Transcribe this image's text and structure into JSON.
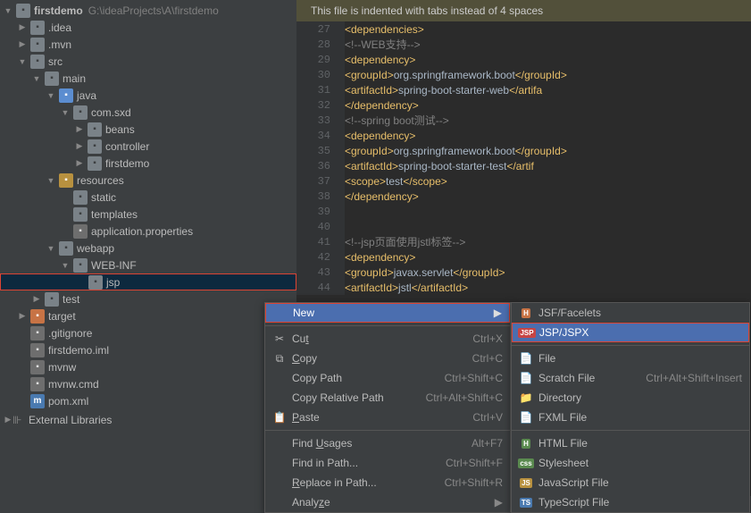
{
  "project": {
    "name": "firstdemo",
    "root": "G:\\ideaProjects\\A\\firstdemo"
  },
  "tree": [
    {
      "lvl": 0,
      "a": "open",
      "ico": "folder",
      "label": "firstdemo",
      "path": 1
    },
    {
      "lvl": 1,
      "a": "closed",
      "ico": "folder",
      "label": ".idea"
    },
    {
      "lvl": 1,
      "a": "closed",
      "ico": "folder",
      "label": ".mvn"
    },
    {
      "lvl": 1,
      "a": "open",
      "ico": "folder",
      "label": "src"
    },
    {
      "lvl": 2,
      "a": "open",
      "ico": "folder",
      "label": "main"
    },
    {
      "lvl": 3,
      "a": "open",
      "ico": "folder-src",
      "label": "java"
    },
    {
      "lvl": 4,
      "a": "open",
      "ico": "folder-pkg",
      "label": "com.sxd"
    },
    {
      "lvl": 5,
      "a": "closed",
      "ico": "folder-pkg",
      "label": "beans"
    },
    {
      "lvl": 5,
      "a": "closed",
      "ico": "folder-pkg",
      "label": "controller"
    },
    {
      "lvl": 5,
      "a": "closed",
      "ico": "folder-pkg",
      "label": "firstdemo"
    },
    {
      "lvl": 3,
      "a": "open",
      "ico": "folder-res",
      "label": "resources"
    },
    {
      "lvl": 4,
      "a": "",
      "ico": "folder",
      "label": "static"
    },
    {
      "lvl": 4,
      "a": "",
      "ico": "folder",
      "label": "templates"
    },
    {
      "lvl": 4,
      "a": "",
      "ico": "file",
      "label": "application.properties"
    },
    {
      "lvl": 3,
      "a": "open",
      "ico": "folder",
      "label": "webapp"
    },
    {
      "lvl": 4,
      "a": "open",
      "ico": "folder",
      "label": "WEB-INF"
    },
    {
      "lvl": 5,
      "a": "",
      "ico": "folder",
      "label": "jsp",
      "sel": 1
    },
    {
      "lvl": 2,
      "a": "closed",
      "ico": "folder",
      "label": "test"
    },
    {
      "lvl": 1,
      "a": "closed",
      "ico": "folder-tgt",
      "label": "target"
    },
    {
      "lvl": 1,
      "a": "",
      "ico": "file",
      "label": ".gitignore"
    },
    {
      "lvl": 1,
      "a": "",
      "ico": "file",
      "label": "firstdemo.iml"
    },
    {
      "lvl": 1,
      "a": "",
      "ico": "file",
      "label": "mvnw"
    },
    {
      "lvl": 1,
      "a": "",
      "ico": "file",
      "label": "mvnw.cmd"
    },
    {
      "lvl": 1,
      "a": "",
      "ico": "m",
      "label": "pom.xml"
    }
  ],
  "ext_lib": "External Libraries",
  "banner": "This file is indented with tabs instead of 4 spaces",
  "code": {
    "start": 27,
    "lines": [
      {
        "ind": 2,
        "t": [
          [
            "tag",
            "<dependencies>"
          ]
        ]
      },
      {
        "ind": 3,
        "t": [
          [
            "cmt",
            "<!--WEB支持-->"
          ]
        ]
      },
      {
        "ind": 3,
        "t": [
          [
            "tag",
            "<dependency>"
          ]
        ]
      },
      {
        "ind": 4,
        "t": [
          [
            "tag",
            "<groupId>"
          ],
          [
            "txt",
            "org.springframework.boot"
          ],
          [
            "tag",
            "</groupId>"
          ]
        ]
      },
      {
        "ind": 4,
        "t": [
          [
            "tag",
            "<artifactId>"
          ],
          [
            "txt",
            "spring-boot-starter-web"
          ],
          [
            "tag",
            "</artifa"
          ]
        ]
      },
      {
        "ind": 3,
        "t": [
          [
            "tag",
            "</dependency>"
          ]
        ]
      },
      {
        "ind": 3,
        "t": [
          [
            "cmt",
            "<!--spring boot测试-->"
          ]
        ]
      },
      {
        "ind": 3,
        "t": [
          [
            "tag",
            "<dependency>"
          ]
        ]
      },
      {
        "ind": 4,
        "t": [
          [
            "tag",
            "<groupId>"
          ],
          [
            "txt",
            "org.springframework.boot"
          ],
          [
            "tag",
            "</groupId>"
          ]
        ]
      },
      {
        "ind": 4,
        "t": [
          [
            "tag",
            "<artifactId>"
          ],
          [
            "txt",
            "spring-boot-starter-test"
          ],
          [
            "tag",
            "</artif"
          ]
        ]
      },
      {
        "ind": 4,
        "t": [
          [
            "tag",
            "<scope>"
          ],
          [
            "txt",
            "test"
          ],
          [
            "tag",
            "</scope>"
          ]
        ]
      },
      {
        "ind": 3,
        "t": [
          [
            "tag",
            "</dependency>"
          ]
        ]
      },
      {
        "ind": 0,
        "t": []
      },
      {
        "ind": 0,
        "t": []
      },
      {
        "ind": 3,
        "t": [
          [
            "cmt",
            "<!--jsp页面使用jstl标签-->"
          ]
        ]
      },
      {
        "ind": 3,
        "t": [
          [
            "tag",
            "<dependency>"
          ]
        ]
      },
      {
        "ind": 4,
        "t": [
          [
            "tag",
            "<groupId>"
          ],
          [
            "txt",
            "javax.servlet"
          ],
          [
            "tag",
            "</groupId>"
          ]
        ]
      },
      {
        "ind": 4,
        "t": [
          [
            "tag",
            "<artifactId>"
          ],
          [
            "txt",
            "jstl"
          ],
          [
            "tag",
            "</artifactId>"
          ]
        ]
      }
    ]
  },
  "menu1": [
    {
      "label": "New",
      "hi": 1,
      "sub": 1,
      "box": 1
    },
    {
      "sep": 1
    },
    {
      "ico": "✂",
      "label": "Cut",
      "u": "t",
      "key": "Ctrl+X"
    },
    {
      "ico": "⧉",
      "label": "Copy",
      "u": "C",
      "key": "Ctrl+C"
    },
    {
      "label": "Copy Path",
      "u": "",
      "key": "Ctrl+Shift+C"
    },
    {
      "label": "Copy Relative Path",
      "key": "Ctrl+Alt+Shift+C"
    },
    {
      "ico": "📋",
      "label": "Paste",
      "u": "P",
      "key": "Ctrl+V"
    },
    {
      "sep": 1
    },
    {
      "label": "Find Usages",
      "u": "U",
      "key": "Alt+F7"
    },
    {
      "label": "Find in Path...",
      "u": "",
      "key": "Ctrl+Shift+F"
    },
    {
      "label": "Replace in Path...",
      "u": "R",
      "key": "Ctrl+Shift+R"
    },
    {
      "label": "Analyze",
      "u": "z",
      "sub": 1
    }
  ],
  "menu2": [
    {
      "ico": "H",
      "c": "#c77345",
      "label": "JSF/Facelets"
    },
    {
      "ico": "JSP",
      "c": "#c74545",
      "label": "JSP/JSPX",
      "hi": 1,
      "box": 1
    },
    {
      "sep": 1
    },
    {
      "ico": "📄",
      "label": "File"
    },
    {
      "ico": "📄",
      "label": "Scratch File",
      "key": "Ctrl+Alt+Shift+Insert"
    },
    {
      "ico": "📁",
      "label": "Directory"
    },
    {
      "ico": "📄",
      "label": "FXML File"
    },
    {
      "sep": 1
    },
    {
      "ico": "H",
      "c": "#5a8a4f",
      "label": "HTML File"
    },
    {
      "ico": "css",
      "c": "#5a8a4f",
      "label": "Stylesheet"
    },
    {
      "ico": "JS",
      "c": "#b8913f",
      "label": "JavaScript File"
    },
    {
      "ico": "TS",
      "c": "#4a7ab0",
      "label": "TypeScript File"
    }
  ]
}
